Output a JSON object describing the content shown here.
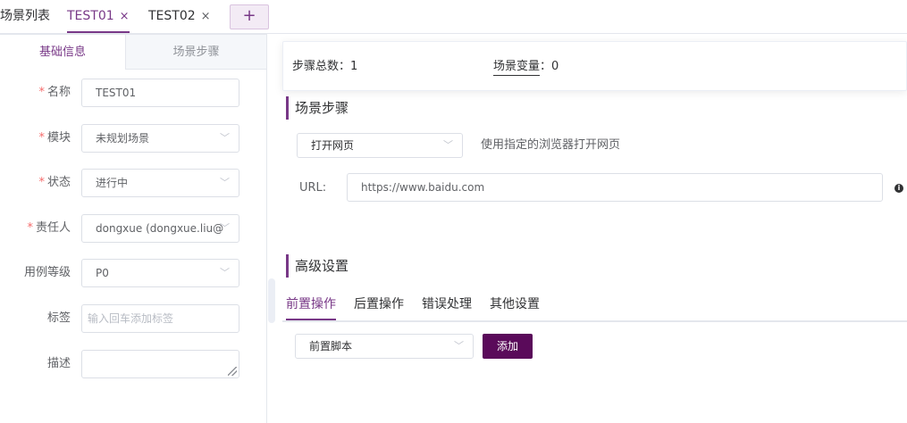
{
  "top_tabs": {
    "list": "场景列表",
    "tab1": "TEST01",
    "tab2": "TEST02",
    "close": "×",
    "add": "+"
  },
  "left_panel": {
    "tabs": [
      "基础信息",
      "场景步骤"
    ],
    "required_mark": "*",
    "fields": {
      "name": {
        "label": "名称",
        "value": "TEST01"
      },
      "module": {
        "label": "模块",
        "value": "未规划场景"
      },
      "status": {
        "label": "状态",
        "value": "进行中"
      },
      "owner": {
        "label": "责任人",
        "value": "dongxue (dongxue.liu@"
      },
      "level": {
        "label": "用例等级",
        "value": "P0"
      },
      "tags": {
        "label": "标签",
        "placeholder": "输入回车添加标签"
      },
      "description": {
        "label": "描述",
        "value": ""
      }
    }
  },
  "summary": {
    "steps_label": "步骤总数：",
    "steps_count": "1",
    "vars_label": "场景变量",
    "vars_sep": "：",
    "vars_count": "0"
  },
  "steps_section": {
    "title": "场景步骤",
    "action_select": "打开网页",
    "action_desc": "使用指定的浏览器打开网页",
    "url_label": "URL:",
    "url_value": "https://www.baidu.com"
  },
  "advanced": {
    "title": "高级设置",
    "tabs": [
      "前置操作",
      "后置操作",
      "错误处理",
      "其他设置"
    ],
    "script_select": "前置脚本",
    "add_button": "添加"
  },
  "colors": {
    "accent": "#783887",
    "button_bg": "#5a0a5a",
    "required": "#f56c6c"
  }
}
